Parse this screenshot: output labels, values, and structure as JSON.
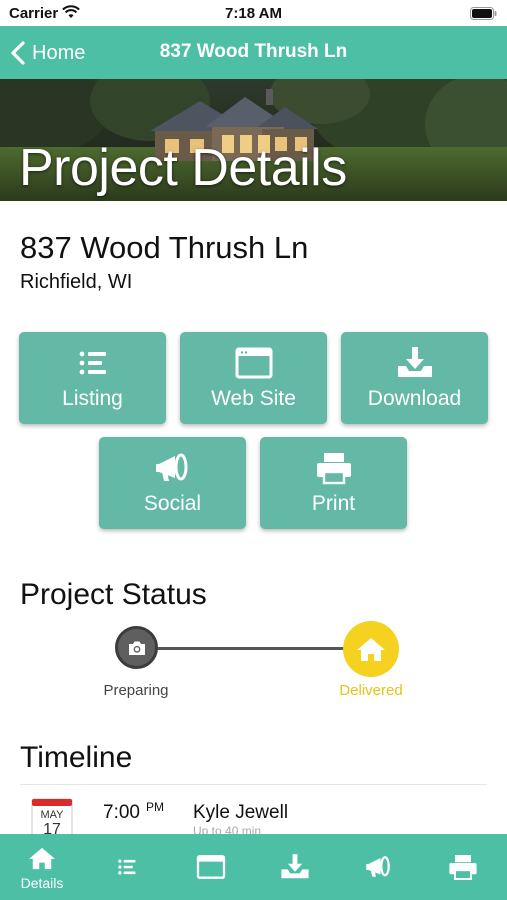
{
  "status_bar": {
    "carrier": "Carrier",
    "time": "7:18 AM"
  },
  "nav": {
    "back_label": "Home",
    "title": "837 Wood Thrush Ln"
  },
  "hero": {
    "title": "Project Details"
  },
  "address": {
    "street": "837 Wood Thrush Ln",
    "city": "Richfield, WI"
  },
  "actions": [
    {
      "label": "Listing",
      "icon": "list-icon"
    },
    {
      "label": "Web Site",
      "icon": "browser-window-icon"
    },
    {
      "label": "Download",
      "icon": "download-icon"
    },
    {
      "label": "Social",
      "icon": "megaphone-icon"
    },
    {
      "label": "Print",
      "icon": "printer-icon"
    }
  ],
  "project_status": {
    "heading": "Project Status",
    "steps": [
      {
        "label": "Preparing",
        "icon": "camera-icon"
      },
      {
        "label": "Delivered",
        "icon": "home-icon"
      }
    ]
  },
  "timeline": {
    "heading": "Timeline",
    "items": [
      {
        "month": "MAY",
        "day": "17",
        "time": "7:00",
        "ampm": "PM",
        "name": "Kyle Jewell",
        "detail": "Up to 40 min"
      }
    ]
  },
  "tab_bar": {
    "tabs": [
      {
        "label": "Details",
        "icon": "home-icon"
      },
      {
        "label": "",
        "icon": "list-icon"
      },
      {
        "label": "",
        "icon": "browser-window-icon"
      },
      {
        "label": "",
        "icon": "download-icon"
      },
      {
        "label": "",
        "icon": "megaphone-icon"
      },
      {
        "label": "",
        "icon": "printer-icon"
      }
    ]
  },
  "colors": {
    "accent": "#4dbfa5",
    "tile": "#63b8a6",
    "delivered": "#f4d21f",
    "preparing": "#5f5f5f"
  }
}
